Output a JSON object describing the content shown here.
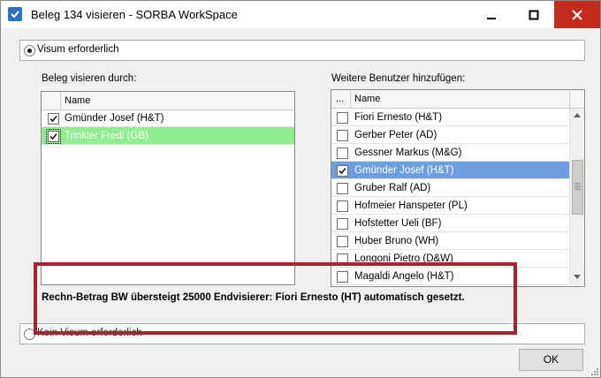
{
  "window": {
    "title": "Beleg 134 visieren - SORBA WorkSpace"
  },
  "visum": {
    "required_label": "Visum erforderlich",
    "not_required_label": "Kein Visum erforderlich"
  },
  "left_panel": {
    "heading": "Beleg visieren durch:",
    "column_name": "Name",
    "rows": [
      {
        "name": "Gmünder Josef (H&T)",
        "checked": true,
        "highlight": false
      },
      {
        "name": "Trinkler Fredi (GB)",
        "checked": true,
        "highlight": true
      }
    ]
  },
  "right_panel": {
    "heading": "Weitere Benutzer hinzufügen:",
    "column_dots": "...",
    "column_name": "Name",
    "rows": [
      {
        "name": "Fiori Ernesto (H&T)",
        "checked": false,
        "selected": false
      },
      {
        "name": "Gerber Peter (AD)",
        "checked": false,
        "selected": false
      },
      {
        "name": "Gessner Markus (M&G)",
        "checked": false,
        "selected": false
      },
      {
        "name": "Gmünder Josef (H&T)",
        "checked": true,
        "selected": true
      },
      {
        "name": "Gruber Ralf (AD)",
        "checked": false,
        "selected": false
      },
      {
        "name": "Hofmeier Hanspeter (PL)",
        "checked": false,
        "selected": false
      },
      {
        "name": "Hofstetter Ueli (BF)",
        "checked": false,
        "selected": false
      },
      {
        "name": "Huber Bruno (WH)",
        "checked": false,
        "selected": false
      },
      {
        "name": "Longoni Pietro (D&W)",
        "checked": false,
        "selected": false
      },
      {
        "name": "Magaldi Angelo (H&T)",
        "checked": false,
        "selected": false
      }
    ]
  },
  "message": "Rechn-Betrag BW übersteigt 25000 Endvisierer: Fiori Ernesto (HT) automatisch gesetzt.",
  "ok_label": "OK",
  "colors": {
    "selected_row": "#6d9ee0",
    "highlight_row": "#8fef8f",
    "alert_border": "#a6242f",
    "close_button": "#c42b1c"
  },
  "icons": [
    "app-check-icon",
    "minimize-icon",
    "maximize-icon",
    "close-icon",
    "scroll-up-icon",
    "scroll-down-icon",
    "scroll-grip-icon",
    "resize-grip-icon"
  ]
}
